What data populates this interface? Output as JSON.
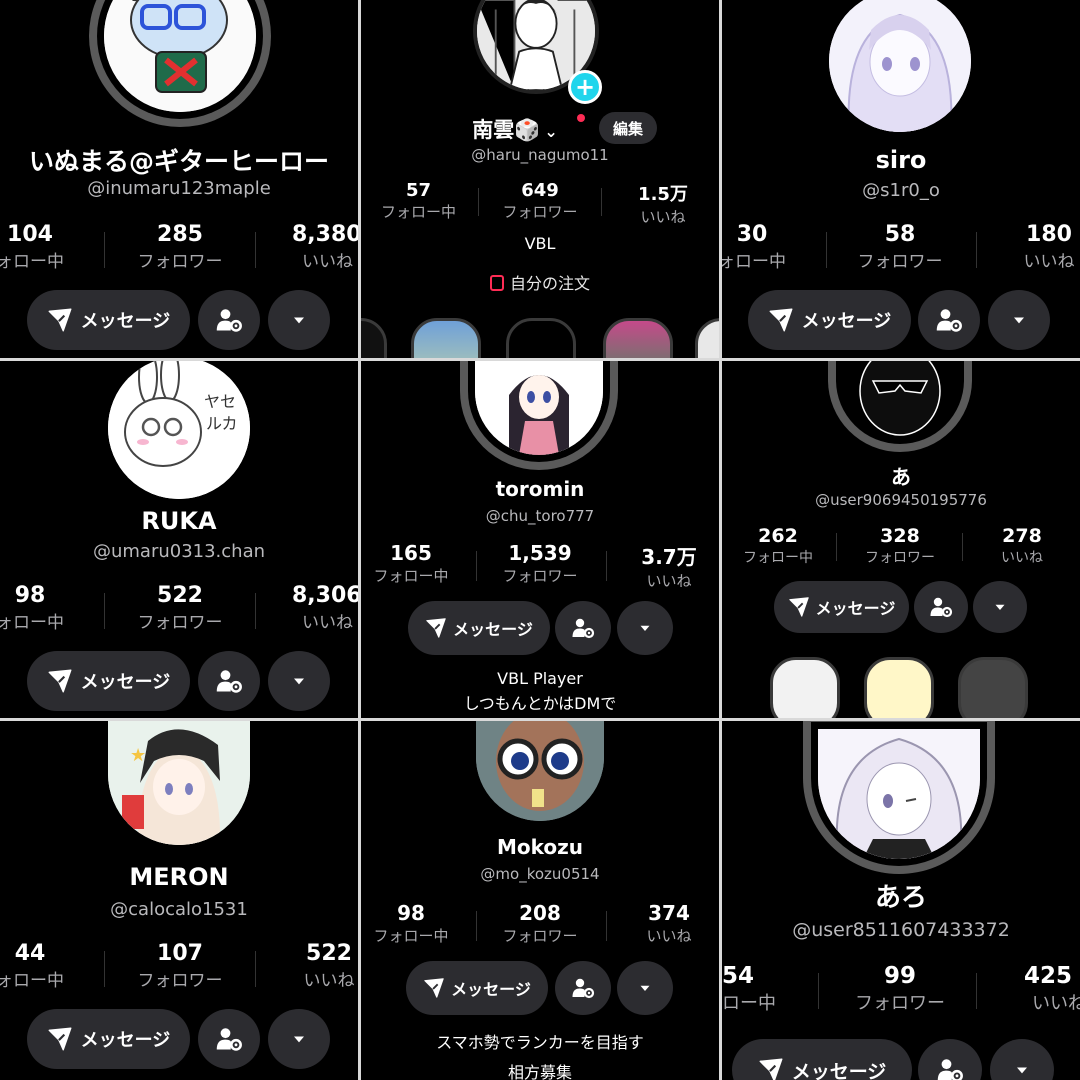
{
  "labels": {
    "following": "フォロー中",
    "following_cut": "ォロー中",
    "following_cut2": "ロー中",
    "followers": "フォロワー",
    "likes": "いいね",
    "message": "メッセージ",
    "edit": "編集",
    "orders": "自分の注文"
  },
  "profiles": [
    {
      "name": "いぬまる@ギターヒーロー",
      "handle": "@inumaru123maple",
      "following": "104",
      "followers": "285",
      "likes": "8,380"
    },
    {
      "name": "南雲🎲",
      "handle": "@haru_nagumo11",
      "following": "57",
      "followers": "649",
      "likes": "1.5万",
      "bio": "VBL"
    },
    {
      "name": "siro",
      "handle": "@s1r0_o",
      "following": "30",
      "followers": "58",
      "likes": "180"
    },
    {
      "name": "RUKA",
      "handle": "@umaru0313.chan",
      "following": "98",
      "followers": "522",
      "likes": "8,306"
    },
    {
      "name": "toromin",
      "handle": "@chu_toro777",
      "following": "165",
      "followers": "1,539",
      "likes": "3.7万",
      "bio1": "VBL Player",
      "bio2": "しつもんとかはDMで"
    },
    {
      "name": "あ",
      "handle": "@user9069450195776",
      "following": "262",
      "followers": "328",
      "likes": "278"
    },
    {
      "name": "MERON",
      "handle": "@calocalo1531",
      "following": "44",
      "followers": "107",
      "likes": "522"
    },
    {
      "name": "Mokozu",
      "handle": "@mo_kozu0514",
      "following": "98",
      "followers": "208",
      "likes": "374",
      "bio1": "スマホ勢でランカーを目指す",
      "bio2": "相方募集"
    },
    {
      "name": "あろ",
      "handle": "@user8511607433372",
      "following": "54",
      "followers": "99",
      "likes": "425"
    }
  ],
  "icons": {
    "send": "send-icon",
    "add_friend": "person-settings-icon",
    "dropdown": "chevron-down-icon",
    "plus": "plus-icon",
    "bag": "shopping-bag-icon"
  },
  "colors": {
    "background": "#000000",
    "button": "#2c2c30",
    "accent_plus": "#20d5ec",
    "bag": "#fe2c55",
    "divider": "#d9d9d9"
  }
}
